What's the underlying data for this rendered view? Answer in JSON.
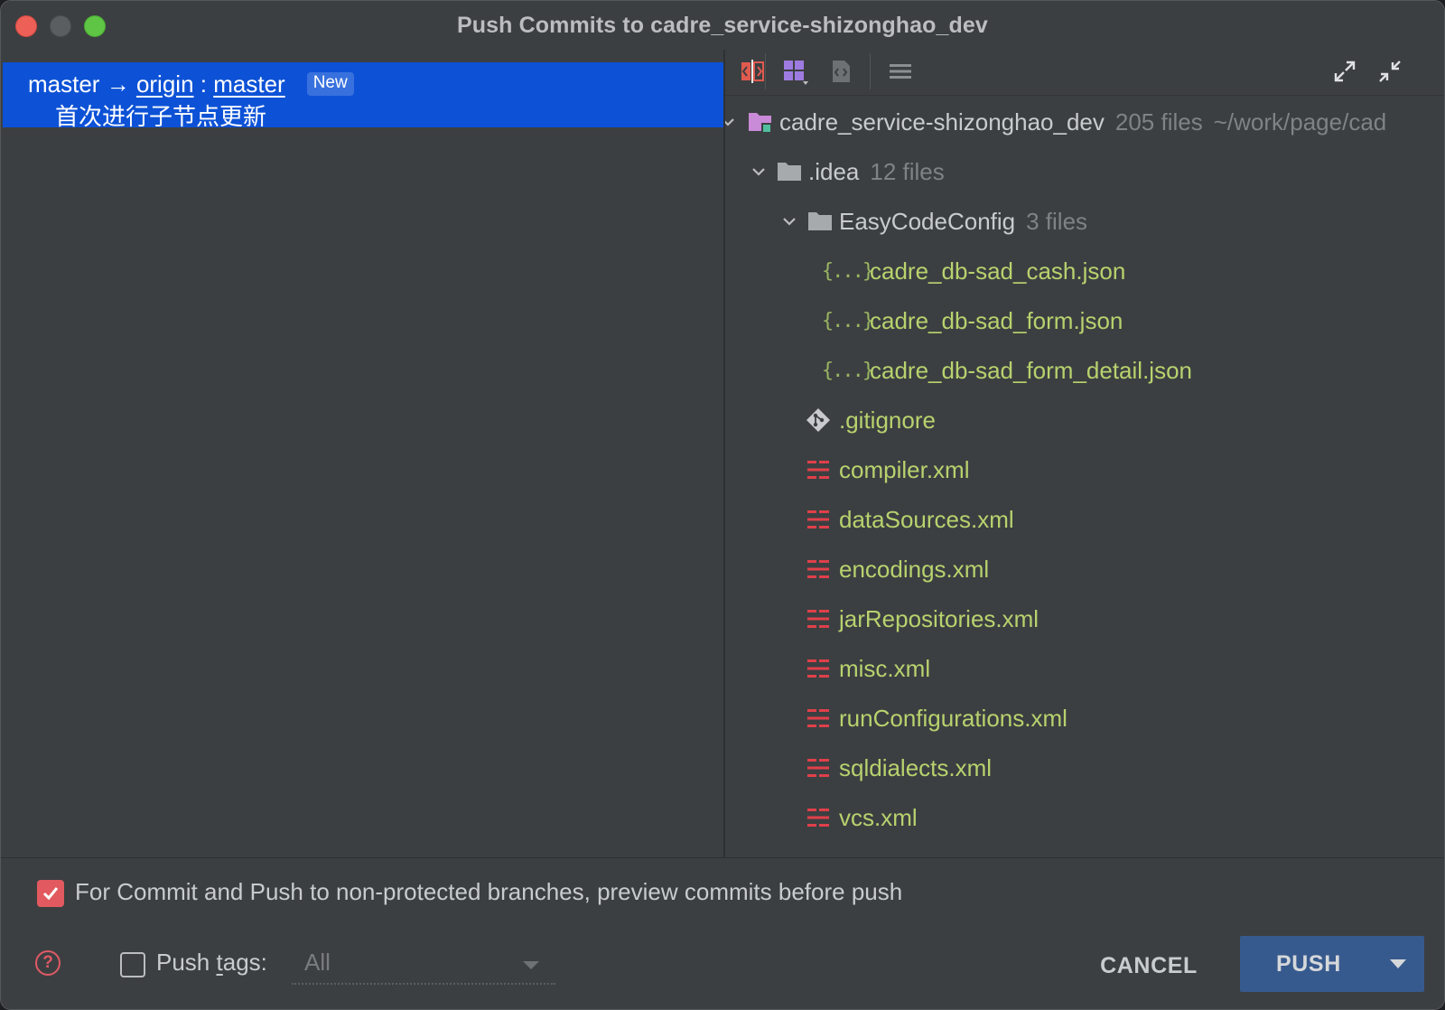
{
  "window": {
    "title": "Push Commits to cadre_service-shizonghao_dev"
  },
  "branch": {
    "local": "master",
    "arrow": "→",
    "remote": "origin",
    "separator": ":",
    "remote_branch": "master",
    "badge": "New",
    "commit_message": "首次进行子节点更新"
  },
  "tree": {
    "root": {
      "name": "cadre_service-shizonghao_dev",
      "count": "205 files",
      "path": "~/work/page/cad"
    },
    "idea": {
      "name": ".idea",
      "count": "12 files"
    },
    "easycode": {
      "name": "EasyCodeConfig",
      "count": "3 files"
    },
    "json_files": [
      "cadre_db-sad_cash.json",
      "cadre_db-sad_form.json",
      "cadre_db-sad_form_detail.json"
    ],
    "gitignore": ".gitignore",
    "xml_files": [
      "compiler.xml",
      "dataSources.xml",
      "encodings.xml",
      "jarRepositories.xml",
      "misc.xml",
      "runConfigurations.xml",
      "sqldialects.xml",
      "vcs.xml"
    ],
    "json_brace": "{...}"
  },
  "footer": {
    "preview_checkbox_label": "For Commit and Push to non-protected branches, preview commits before push",
    "preview_checked": true,
    "push_tags_label_pre": "Push ",
    "push_tags_label_mnemonic": "t",
    "push_tags_label_post": "ags:",
    "push_tags_value": "All",
    "help": "?",
    "cancel": "CANCEL",
    "push": "PUSH"
  },
  "colors": {
    "accent_selection": "#0d52d6",
    "push_button": "#375a8e",
    "json_text": "#b8d26e",
    "xml_icon": "#e0404a",
    "folder_root": "#c98ad8"
  },
  "icons": {
    "toolbar": [
      "show-diff-icon",
      "group-by-icon",
      "file-diff-icon",
      "menu-lines-icon",
      "expand-all-icon",
      "collapse-all-icon"
    ]
  }
}
